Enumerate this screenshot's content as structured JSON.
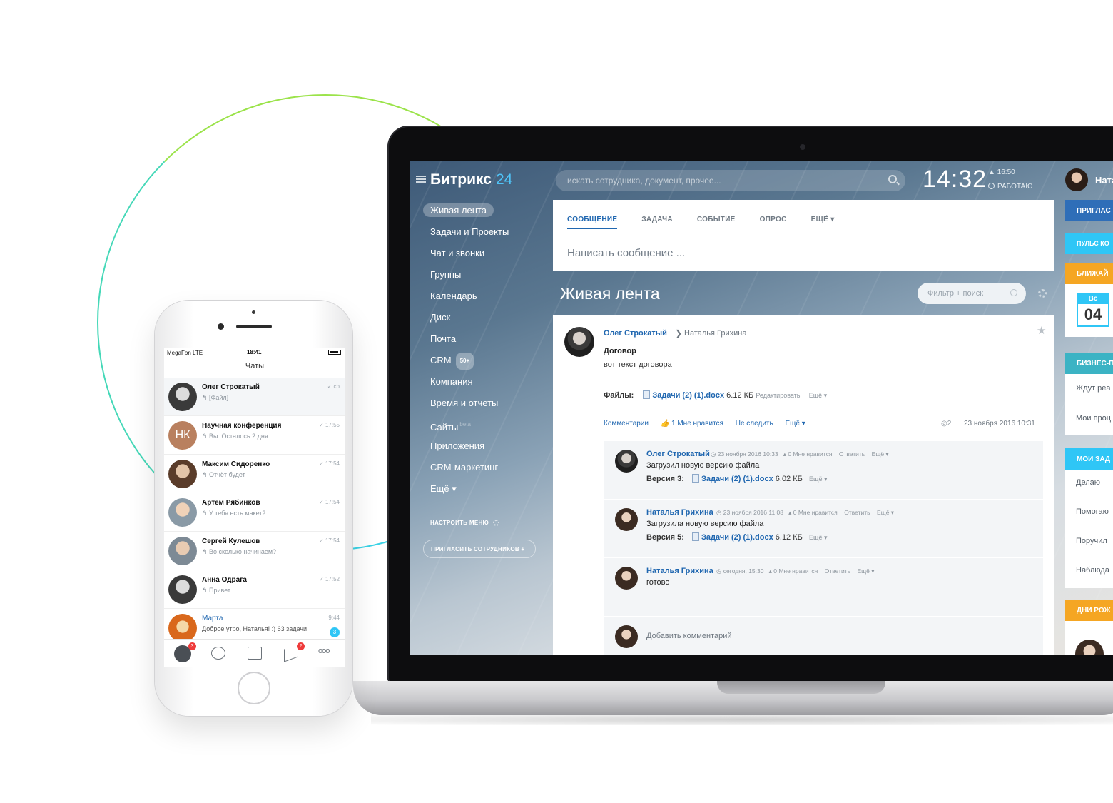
{
  "laptop": {
    "logo": {
      "name": "Битрикс",
      "num": "24"
    },
    "search": {
      "placeholder": "искать сотрудника, документ, прочее..."
    },
    "clock": "14:32",
    "alarm": "▲ 16:50",
    "status": "РАБОТАЮ",
    "user": "Ната",
    "menu": [
      {
        "label": "Живая лента",
        "active": true
      },
      {
        "label": "Задачи и Проекты"
      },
      {
        "label": "Чат и звонки"
      },
      {
        "label": "Группы"
      },
      {
        "label": "Календарь"
      },
      {
        "label": "Диск"
      },
      {
        "label": "Почта"
      },
      {
        "label": "CRM",
        "badge": "50+"
      },
      {
        "label": "Компания"
      },
      {
        "label": "Время и отчеты"
      },
      {
        "label": "Сайты",
        "tag": "beta"
      },
      {
        "label": "Приложения"
      },
      {
        "label": "CRM-маркетинг"
      },
      {
        "label": "Ещё ▾"
      }
    ],
    "setup_menu": "НАСТРОИТЬ МЕНЮ",
    "invite": "ПРИГЛАСИТЬ СОТРУДНИКОВ  +",
    "composer": {
      "tabs": [
        "СООБЩЕНИЕ",
        "ЗАДАЧА",
        "СОБЫТИЕ",
        "ОПРОС",
        "ЕЩЁ ▾"
      ],
      "placeholder": "Написать сообщение ..."
    },
    "feed_title": "Живая лента",
    "filter": "Фильтр + поиск",
    "post": {
      "author": "Олег Строкатый",
      "recipient": "Наталья Грихина",
      "title": "Договор",
      "text": "вот текст договора",
      "files_label": "Файлы:",
      "file": "Задачи (2) (1).docx",
      "size": "6.12 КБ",
      "edit": "Редактировать",
      "more": "Ещё ▾",
      "actions": [
        "Комментарии",
        "1 Мне нравится",
        "Не следить",
        "Ещё ▾"
      ],
      "views": "2",
      "date": "23 ноября 2016 10:31",
      "comments": [
        {
          "author": "Олег Строкатый",
          "date": "23 ноября 2016 10:33",
          "likes": "0 Мне нравится",
          "reply": "Ответить",
          "more": "Ещё ▾",
          "text": "Загрузил новую версию файла",
          "version": "Версия 3:",
          "file": "Задачи (2) (1).docx",
          "size": "6.02 КБ",
          "vmore": "Ещё ▾"
        },
        {
          "author": "Наталья Грихина",
          "date": "23 ноября 2016 11:08",
          "likes": "0 Мне нравится",
          "reply": "Ответить",
          "more": "Ещё ▾",
          "text": "Загрузила новую версию файла",
          "version": "Версия 5:",
          "file": "Задачи (2) (1).docx",
          "size": "6.12 КБ",
          "vmore": "Ещё ▾"
        },
        {
          "author": "Наталья Грихина",
          "date": "сегодня, 15:30",
          "likes": "0 Мне нравится",
          "reply": "Ответить",
          "more": "Ещё ▾",
          "text": "готово"
        }
      ],
      "add_comment": "Добавить комментарий"
    },
    "right": {
      "invite": "ПРИГЛАС",
      "pulse": "ПУЛЬС КО",
      "upcoming": "БЛИЖАЙ",
      "cal_day": "Вс",
      "cal_num": "04",
      "business": "БИЗНЕС-П",
      "business_items": [
        "Ждут реа",
        "Мои проц"
      ],
      "tasks": "МОИ ЗАД",
      "tasks_items": [
        "Делаю",
        "Помогаю",
        "Поручил",
        "Наблюда"
      ],
      "birthdays": "ДНИ РОЖ",
      "colors": {
        "blue": "#2f6eb8",
        "cyan": "#2fc6f6",
        "orange": "#f5a623",
        "teal": "#3bb3c4"
      }
    }
  },
  "phone": {
    "carrier": "MegaFon  LTE",
    "time": "18:41",
    "title": "Чаты",
    "chats": [
      {
        "name": "Олег Строкатый",
        "msg": "↰ [Файл]",
        "time": "✓ ср"
      },
      {
        "name": "Научная конференция",
        "initials": "НК",
        "msg": "↰ Вы: Осталось 2 дня",
        "time": "✓ 17:55"
      },
      {
        "name": "Максим Сидоренко",
        "msg": "↰ Отчёт будет",
        "time": "✓ 17:54"
      },
      {
        "name": "Артем Рябинков",
        "msg": "↰ У тебя есть макет?",
        "time": "✓ 17:54"
      },
      {
        "name": "Сергей Кулешов",
        "msg": "↰ Во сколько начинаем?",
        "time": "✓ 17:54"
      },
      {
        "name": "Анна Одрага",
        "msg": "↰ Привет",
        "time": "✓ 17:52"
      },
      {
        "name": "Марта",
        "msg": "Доброе утро, Наталья! :)  63 задачи",
        "time": "9:44",
        "unread": "3"
      }
    ],
    "tab_badges": [
      "3",
      "2"
    ],
    "tab_more": "ooo"
  }
}
